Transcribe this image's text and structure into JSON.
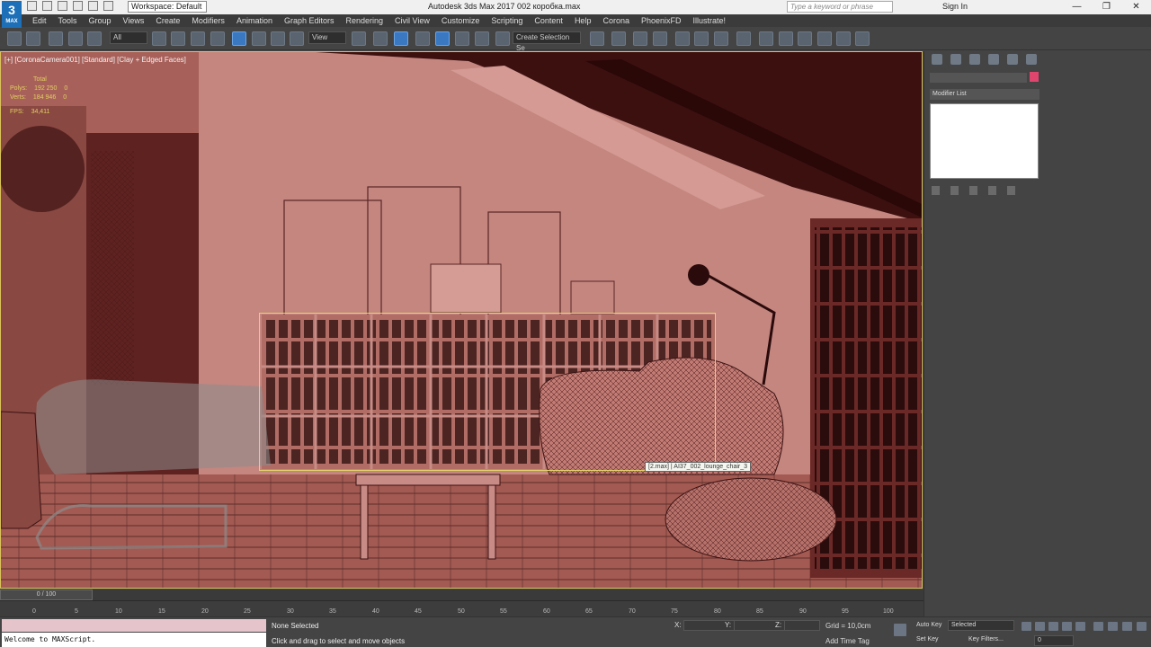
{
  "app": {
    "logo_text": "3",
    "logo_sub": "MAX",
    "title": "Autodesk 3ds Max 2017     002 коробка.max",
    "workspace": "Workspace: Default",
    "search_placeholder": "Type a keyword or phrase",
    "signin": "Sign In",
    "win_minimize": "—",
    "win_restore": "❐",
    "win_close": "✕"
  },
  "menu": [
    "Edit",
    "Tools",
    "Group",
    "Views",
    "Create",
    "Modifiers",
    "Animation",
    "Graph Editors",
    "Rendering",
    "Civil View",
    "Customize",
    "Scripting",
    "Content",
    "Help",
    "Corona",
    "PhoenixFD",
    "Illustrate!"
  ],
  "toolbar": {
    "filter_value": "All",
    "coord_value": "View",
    "selection_set": "Create Selection Se"
  },
  "viewport": {
    "label": "[+] [CoronaCamera001] [Standard] [Clay + Edged Faces]",
    "stats": {
      "header": "Total",
      "polys_label": "Polys:",
      "polys_total": "192 250",
      "polys_sel": "0",
      "verts_label": "Verts:",
      "verts_total": "184 946",
      "verts_sel": "0",
      "fps_label": "FPS:",
      "fps": "34,411"
    },
    "tooltip": "[2.max] | AI37_002_lounge_chair_3",
    "colors": {
      "background": "#6b3a38",
      "wall": "#c98b85",
      "wood": "#a35a52",
      "dark": "#3a1414",
      "selection": "#e2d46a"
    }
  },
  "command_panel": {
    "modifier_list": "Modifier List",
    "selection_color": "#e0456e"
  },
  "timeline": {
    "frame": "0 / 100",
    "ticks": [
      "0",
      "5",
      "10",
      "15",
      "20",
      "25",
      "30",
      "35",
      "40",
      "45",
      "50",
      "55",
      "60",
      "65",
      "70",
      "75",
      "80",
      "85",
      "90",
      "95",
      "100"
    ]
  },
  "status": {
    "maxscript": "Welcome to MAXScript.",
    "selection": "None Selected",
    "prompt": "Click and drag to select and move objects",
    "x_label": "X:",
    "y_label": "Y:",
    "z_label": "Z:",
    "grid": "Grid = 10,0cm",
    "add_time_tag": "Add Time Tag",
    "auto_key": "Auto Key",
    "set_key": "Set Key",
    "key_mode": "Selected",
    "key_filters": "Key Filters...",
    "current_frame": "0"
  }
}
